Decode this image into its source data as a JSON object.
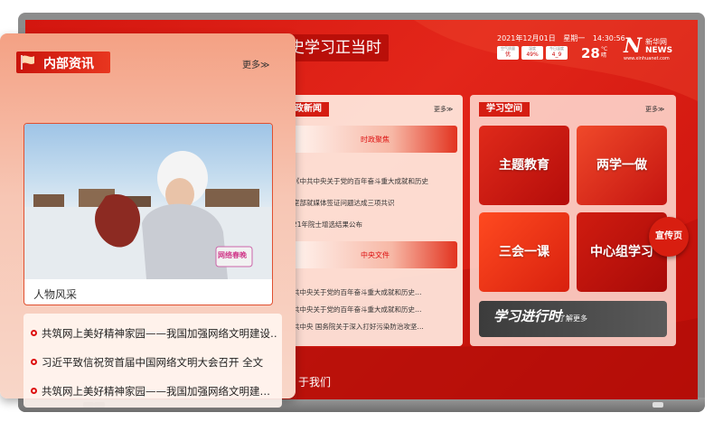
{
  "header": {
    "slogan": "史学习正当时",
    "date": "2021年12月01日",
    "weekday": "星期一",
    "time": "14:30:56",
    "metrics": [
      {
        "label": "空气质量",
        "value": "优"
      },
      {
        "label": "湿度",
        "value": "49%"
      },
      {
        "label": "今日温度",
        "value": "4_9"
      }
    ],
    "temperature": "28",
    "temp_unit": "°C",
    "temp_desc": "晴",
    "logo_main": "N",
    "logo_sub": "新华网",
    "logo_news": "NEWS",
    "logo_url": "www.xinhuanet.com"
  },
  "policy_news": {
    "title": "政新闻",
    "more": "更多≫",
    "section1_title": "时政聚焦",
    "section1_items": [
      "《中共中央关于党的百年奋斗重大成就和历史",
      "室部就媒体签证问题达成三项共识",
      "21年院士增选结果公布"
    ],
    "section2_title": "中央文件",
    "section2_items": [
      "共中央关于党的百年奋斗重大成就和历史…",
      "共中央关于党的百年奋斗重大成就和历史…",
      "共中央 国务院关于深入打好污染防治攻坚…"
    ]
  },
  "learning": {
    "title": "学习空间",
    "more": "更多≫",
    "tiles": [
      "主题教育",
      "两学一做",
      "三会一课",
      "中心组学习"
    ],
    "learn_more": "了解更多",
    "brush_text": "学习进行时"
  },
  "float_button": "宣传页",
  "footer": {
    "about": "于我们"
  },
  "internal_news": {
    "title": "内部资讯",
    "more": "更多≫",
    "photo_badge": "网络春晚",
    "caption": "人物风采",
    "items": [
      "共筑网上美好精神家园——我国加强网络文明建设…",
      "习近平致信祝贺首届中国网络文明大会召开 全文",
      "共筑网上美好精神家园——我国加强网络文明建…"
    ]
  }
}
